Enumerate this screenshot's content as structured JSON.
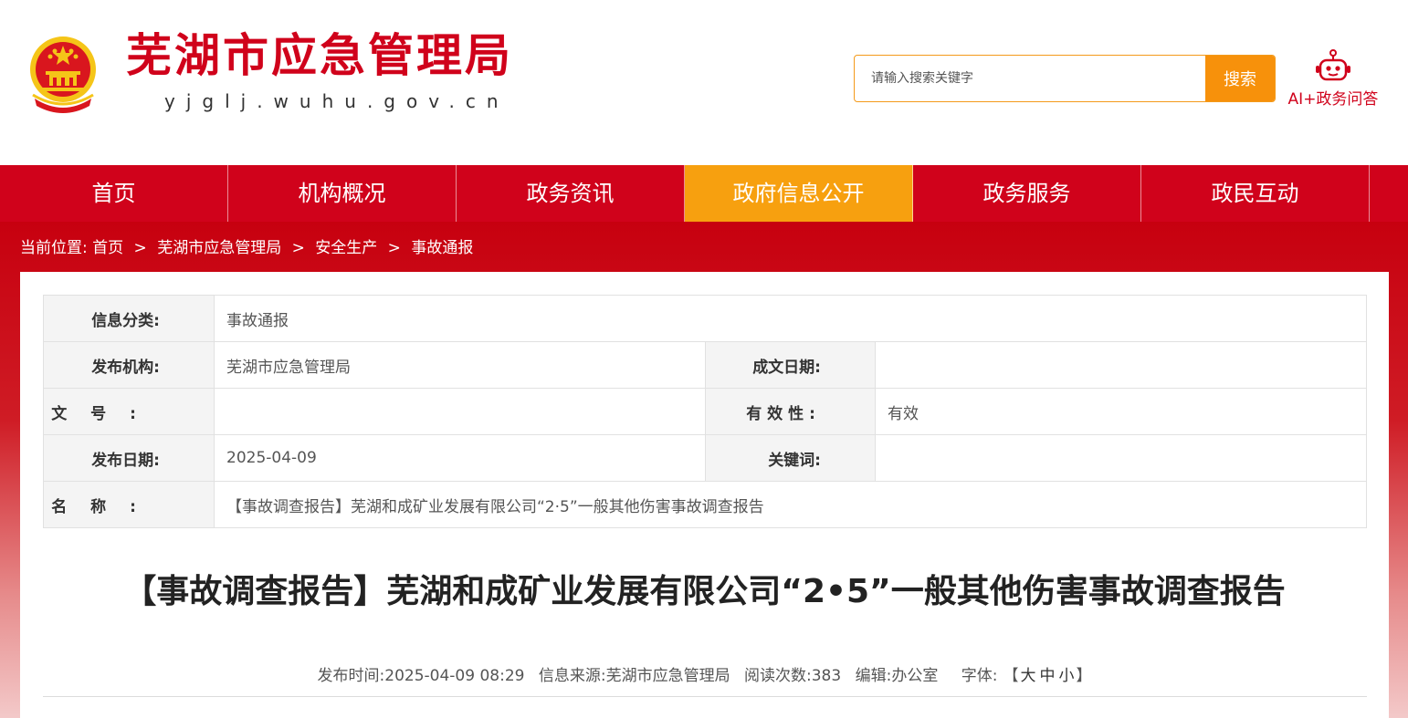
{
  "header": {
    "site_title": "芜湖市应急管理局",
    "site_domain": "yjglj.wuhu.gov.cn",
    "search_placeholder": "请输入搜索关键字",
    "search_button": "搜索",
    "ai_label": "AI+政务问答",
    "icon": "robot-icon"
  },
  "nav": {
    "items": [
      {
        "label": "首页"
      },
      {
        "label": "机构概况"
      },
      {
        "label": "政务资讯"
      },
      {
        "label": "政府信息公开",
        "active": true
      },
      {
        "label": "政务服务"
      },
      {
        "label": "政民互动"
      }
    ]
  },
  "breadcrumb": {
    "prefix": "当前位置:",
    "items": [
      "首页",
      "芜湖市应急管理局",
      "安全生产",
      "事故通报"
    ],
    "separator": ">"
  },
  "info": {
    "category_label": "信息分类:",
    "category_value": "事故通报",
    "publisher_label": "发布机构:",
    "publisher_value": "芜湖市应急管理局",
    "doc_date_label": "成文日期:",
    "doc_date_value": "",
    "doc_no_label": "文号:",
    "doc_no_value": "",
    "validity_label": "有效性:",
    "validity_value": "有效",
    "pub_date_label": "发布日期:",
    "pub_date_value": "2025-04-09",
    "keywords_label": "关键词:",
    "keywords_value": "",
    "name_label": "名称:",
    "name_value": "【事故调查报告】芜湖和成矿业发展有限公司“2·5”一般其他伤害事故调查报告"
  },
  "article": {
    "title": "【事故调查报告】芜湖和成矿业发展有限公司“2•5”一般其他伤害事故调查报告",
    "publish_time": "发布时间:2025-04-09 08:29",
    "source": "信息来源:芜湖市应急管理局",
    "read_count": "阅读次数:383",
    "editor": "编辑:办公室",
    "font_label": "字体:",
    "font_open": "【",
    "font_large": "大",
    "font_medium": "中",
    "font_small": "小",
    "font_close": "】"
  },
  "colors": {
    "brand_red": "#d0021b",
    "accent_orange": "#f7a00f"
  }
}
